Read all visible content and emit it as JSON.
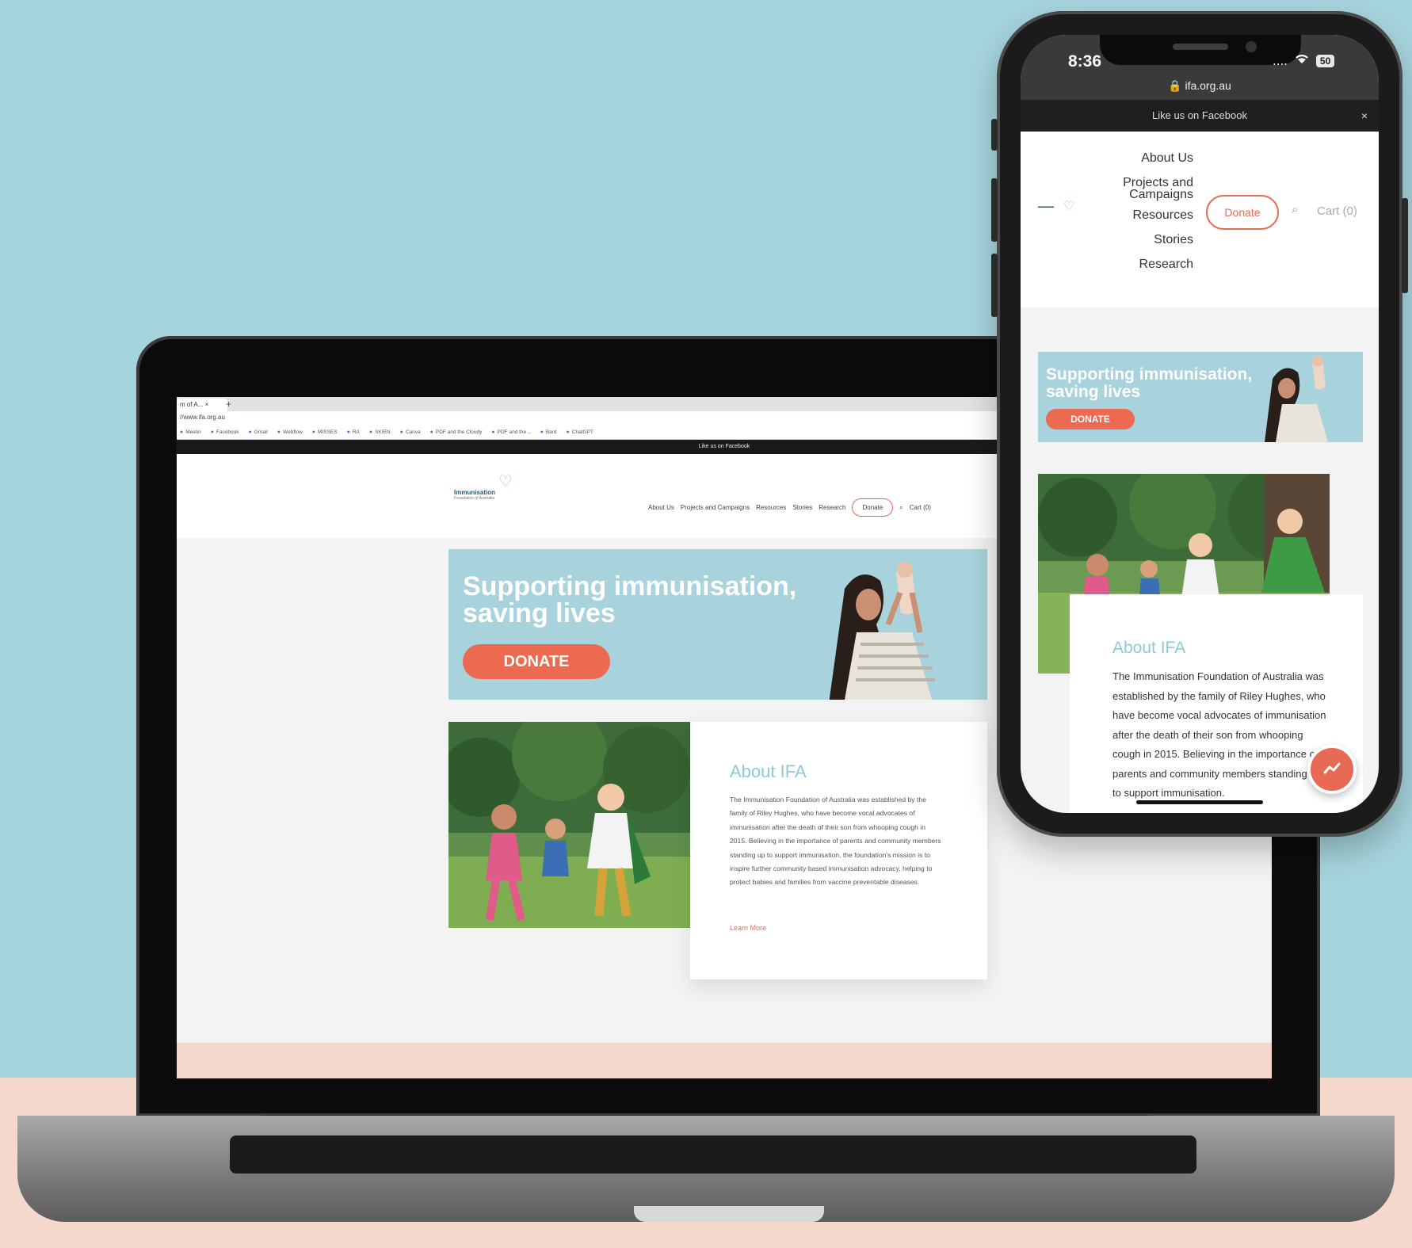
{
  "laptop": {
    "browser": {
      "tab_label": "m of A...  ×",
      "new_tab": "+",
      "url": "//www.ifa.org.au",
      "bookmarks": [
        "Meetin",
        "Facebook",
        "Gmail",
        "Webflow",
        "MISSES",
        "RA",
        "SKIEN",
        "Canva",
        "PDF and the Cloudy",
        "PDF and the ..",
        "Bard",
        "ChatGPT"
      ]
    },
    "site": {
      "fb_bar": "Like us on Facebook",
      "logo_line1": "Immunisation",
      "logo_line2": "Foundation of Australia",
      "nav": [
        "About Us",
        "Projects and Campaigns",
        "Resources",
        "Stories",
        "Research"
      ],
      "donate_button": "Donate",
      "search_icon": "search-icon",
      "cart": "Cart (0)",
      "banner_headline": "Supporting immunisation, saving lives",
      "banner_button": "DONATE",
      "about_heading": "About IFA",
      "about_text": "The Immunisation Foundation of Australia was established by the family of Riley Hughes, who have become vocal advocates of immunisation after the death of their son from whooping cough in 2015. Believing in the importance of parents and community members standing up to support immunisation, the foundation's mission is to inspire further community based immunisation advocacy, helping to protect babies and families from vaccine preventable diseases.",
      "learn_more": "Learn More"
    }
  },
  "phone": {
    "time": "8:36",
    "signal": "....",
    "wifi_icon": "wifi-icon",
    "battery": "50",
    "url": "ifa.org.au",
    "fb_bar": "Like us on Facebook",
    "fb_close": "×",
    "nav": [
      "About Us",
      "Projects and Campaigns",
      "Resources",
      "Stories",
      "Research"
    ],
    "donate_button": "Donate",
    "cart": "Cart (0)",
    "banner_headline": "Supporting immunisation, saving lives",
    "banner_button": "DONATE",
    "about_heading": "About IFA",
    "about_text": "The Immunisation Foundation of Australia was established by the family of Riley Hughes, who have become vocal advocates of immunisation after the death of their son from whooping cough in 2015. Believing in the importance of parents and community members standing up to support immunisation."
  },
  "colors": {
    "background": "#a6d4dd",
    "floor": "#f3d8cb",
    "banner": "#a8d3dc",
    "accent": "#ec6a50",
    "heading": "#8ccbd3"
  }
}
